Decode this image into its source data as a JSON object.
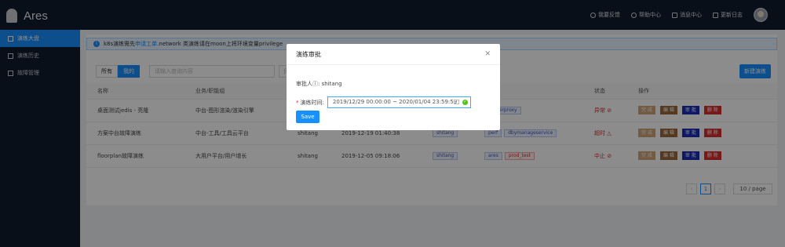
{
  "app": {
    "title": "Ares"
  },
  "topbar": {
    "actions": [
      {
        "label": "我要反馈",
        "icon": "feedback-icon"
      },
      {
        "label": "帮助中心",
        "icon": "help-icon"
      },
      {
        "label": "消息中心",
        "icon": "message-icon"
      },
      {
        "label": "更新日志",
        "icon": "changelog-icon"
      }
    ]
  },
  "sidebar": {
    "items": [
      {
        "label": "演练大盘",
        "icon": "home-icon",
        "active": true
      },
      {
        "label": "演练历史",
        "icon": "home-icon",
        "active": false
      },
      {
        "label": "故障管理",
        "icon": "file-icon",
        "active": false
      }
    ]
  },
  "notice": {
    "prefix": "k8s演练需先",
    "link": "申请工单",
    "suffix": ".network 类演练请在moon上将环境变量privilege"
  },
  "toolbar": {
    "all": "所有",
    "mine": "我的",
    "search_placeholder": "请输入查询内容",
    "search2_placeholder": "负",
    "new_label": "新建演练"
  },
  "table": {
    "headers": [
      "名称",
      "业务/职能组",
      "",
      "",
      "",
      "",
      "状态",
      "操作"
    ],
    "rows": [
      {
        "name": "桌面测试jedis - 亮隆",
        "group": "中台-图形渲染/渲染引擎",
        "owner": "",
        "time": "",
        "tag1": "",
        "tags": [
          "renderproxy"
        ],
        "status": "异常"
      },
      {
        "name": "方案中台故障演练",
        "group": "中台-工具/工具云平台",
        "owner": "shitang",
        "time": "2019-12-19 01:40:38",
        "tag1": "shitang",
        "tags": [
          "perf",
          "dbymanageservice"
        ],
        "status": "超时"
      },
      {
        "name": "floorplan故障演练",
        "group": "大用户平台/用户增长",
        "owner": "shitang",
        "time": "2019-12-05 09:18:06",
        "tag1": "shitang",
        "tags": [
          "ares",
          "prod_test"
        ],
        "status": "中止"
      }
    ],
    "ops": [
      "完 成",
      "编 辑",
      "审 批",
      "删 除"
    ]
  },
  "pager": {
    "current": "1",
    "size": "10 / page"
  },
  "modal": {
    "title": "演练审批",
    "approver_label": "审批人",
    "approver_value": "shitang",
    "time_label": "演练时间:",
    "time_value": "2019/12/29 00:00:00  ~  2020/01/04 23:59:59",
    "save": "Save"
  },
  "colors": {
    "accent": "#1890ff",
    "nav": "#0f1d2f",
    "danger": "#d92f2f"
  }
}
